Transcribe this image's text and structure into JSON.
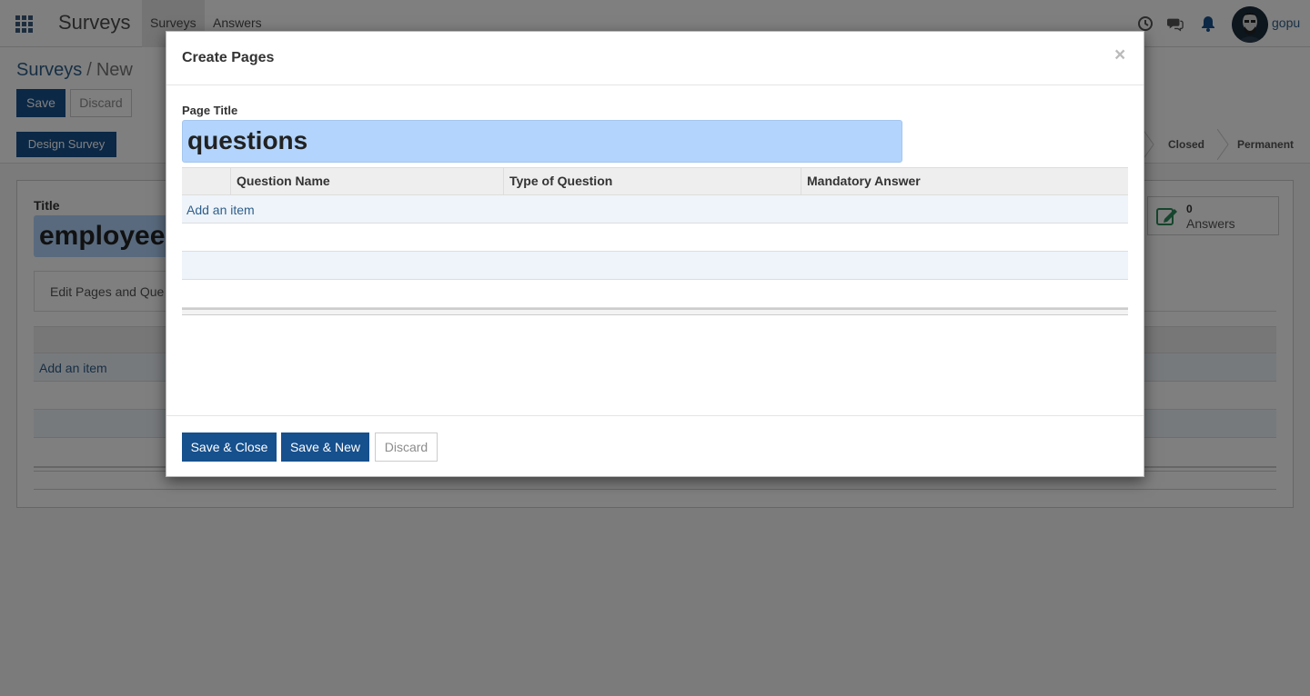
{
  "navbar": {
    "app_title": "Surveys",
    "menu": [
      "Surveys",
      "Answers"
    ],
    "username": "gopu",
    "icons": [
      "apps-grid-icon",
      "clock-icon",
      "chat-icon",
      "bell-icon"
    ]
  },
  "control_panel": {
    "breadcrumb_parent": "Surveys",
    "breadcrumb_sep": "/",
    "breadcrumb_current": "New",
    "save_label": "Save",
    "discard_label": "Discard",
    "design_label": "Design Survey",
    "stages": [
      "Closed",
      "Permanent"
    ]
  },
  "form": {
    "title_label": "Title",
    "title_value": "employee",
    "answers_count": "0",
    "answers_label": "Answers",
    "tab_label": "Edit Pages and Que",
    "add_item": "Add an item"
  },
  "modal": {
    "title": "Create Pages",
    "close": "×",
    "page_title_label": "Page Title",
    "page_title_value": "questions",
    "columns": [
      "Question Name",
      "Type of Question",
      "Mandatory Answer"
    ],
    "add_item": "Add an item",
    "save_close": "Save & Close",
    "save_new": "Save & New",
    "discard": "Discard"
  },
  "colors": {
    "primary": "#16508d",
    "link": "#2f5f8a",
    "highlight": "#b3d4fc",
    "row_alt": "#eef4fa"
  }
}
